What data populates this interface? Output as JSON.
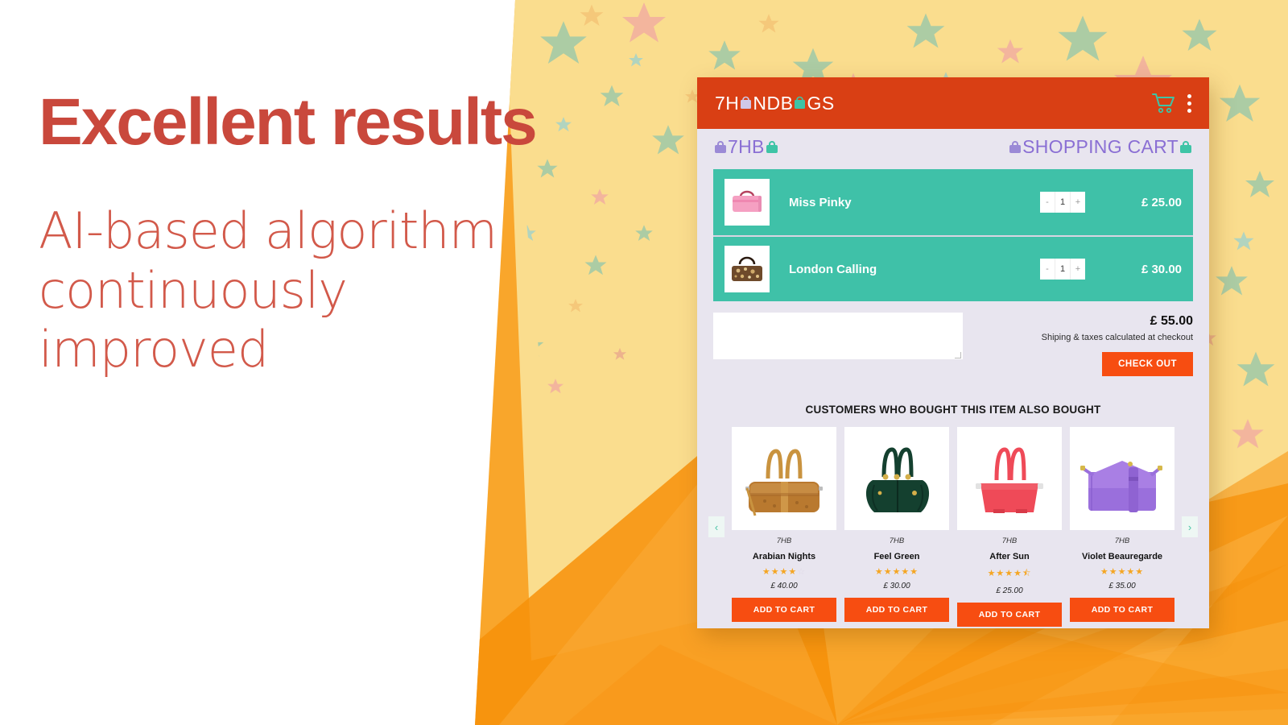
{
  "promo": {
    "headline": "Excellent results",
    "subhead_lines": [
      "AI-based algorithm",
      "continuously",
      "improved"
    ],
    "headline_color": "#c9483c",
    "subhead_color": "#d2594a"
  },
  "app": {
    "logo": {
      "prefix": "7H",
      "mid": "ND",
      "b": "B",
      "suffix": "GS"
    },
    "topbar_color": "#d93f14",
    "accent_color": "#f74d11",
    "cart_color": "#3fc1a8",
    "icons": {
      "cart": "shopping-cart-icon",
      "menu": "kebab-menu-icon"
    }
  },
  "breadcrumb": {
    "left": "7HB",
    "right": "SHOPPING CART"
  },
  "cart": {
    "items": [
      {
        "name": "Miss Pinky",
        "qty": "1",
        "price": "£ 25.00",
        "minus": "-",
        "plus": "+",
        "bag_color": "#f5a0c2",
        "handle_color": "#b5435f"
      },
      {
        "name": "London Calling",
        "qty": "1",
        "price": "£ 30.00",
        "minus": "-",
        "plus": "+",
        "bag_color": "#6e4a2b",
        "handle_color": "#2a1a10"
      }
    ],
    "total": "£ 55.00",
    "shipping_note": "Shiping & taxes calculated at checkout",
    "checkout_label": "CHECK OUT",
    "note_placeholder": ""
  },
  "recommendations": {
    "title": "CUSTOMERS WHO BOUGHT THIS ITEM ALSO BOUGHT",
    "prev_label": "‹",
    "next_label": "›",
    "add_to_cart_label": "ADD TO CART",
    "products": [
      {
        "brand": "7HB",
        "name": "Arabian Nights",
        "rating": 4,
        "price": "£ 40.00",
        "bag_color": "#c08a3e",
        "handle_color": "#c9933f",
        "shape": "duffel"
      },
      {
        "brand": "7HB",
        "name": "Feel Green",
        "rating": 5,
        "price": "£ 30.00",
        "bag_color": "#14402f",
        "handle_color": "#14402f",
        "shape": "tote-round"
      },
      {
        "brand": "7HB",
        "name": "After Sun",
        "rating": 4.5,
        "price": "£ 25.00",
        "bag_color": "#ef4a58",
        "handle_color": "#ef4a58",
        "shape": "tote"
      },
      {
        "brand": "7HB",
        "name": "Violet Beauregarde",
        "rating": 5,
        "price": "£ 35.00",
        "bag_color": "#9a6fdc",
        "handle_color": "#9a6fdc",
        "shape": "satchel"
      }
    ]
  },
  "background": {
    "cream": "#fadd8e",
    "orange_mid": "#f9a62b",
    "orange_dark": "#f79009",
    "star_colors": [
      "#f2b0a0",
      "#9ec9a8",
      "#f5c77a",
      "#a9d3c6",
      "#e8a58c",
      "#bcd9b0"
    ]
  }
}
